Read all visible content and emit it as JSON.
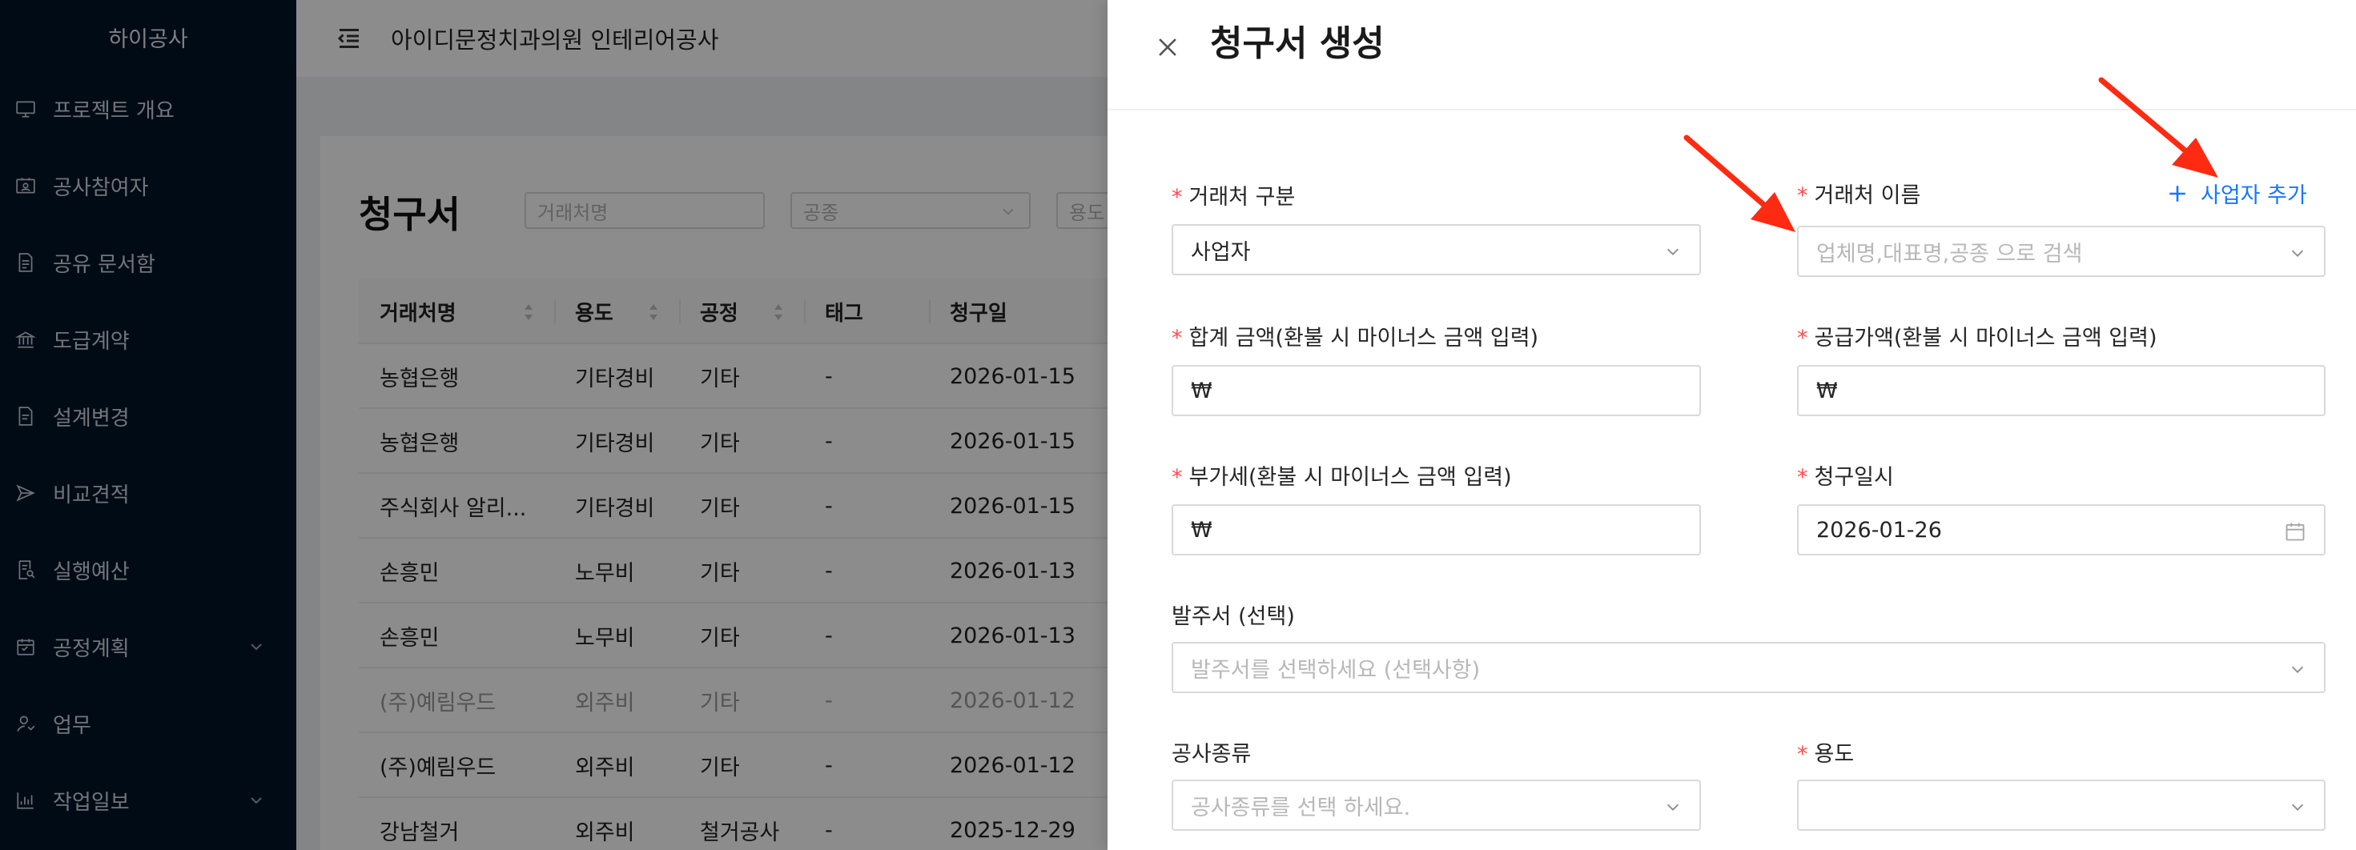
{
  "sidebar": {
    "brand": "하이공사",
    "items": [
      {
        "label": "프로젝트 개요",
        "icon": "monitor-icon"
      },
      {
        "label": "공사참여자",
        "icon": "id-card-icon"
      },
      {
        "label": "공유 문서함",
        "icon": "document-icon"
      },
      {
        "label": "도급계약",
        "icon": "bank-icon"
      },
      {
        "label": "설계변경",
        "icon": "file-edit-icon"
      },
      {
        "label": "비교견적",
        "icon": "send-icon"
      },
      {
        "label": "실행예산",
        "icon": "audit-icon"
      },
      {
        "label": "공정계획",
        "icon": "calendar-icon",
        "expandable": true
      },
      {
        "label": "업무",
        "icon": "user-switch-icon"
      },
      {
        "label": "작업일보",
        "icon": "bar-chart-icon",
        "expandable": true
      }
    ]
  },
  "header": {
    "project_title": "아이디문정치과의원 인테리어공사"
  },
  "page": {
    "title": "청구서",
    "filters": {
      "vendor_placeholder": "거래처명",
      "trade_placeholder": "공종",
      "usage_placeholder": "용도"
    }
  },
  "table": {
    "columns": [
      "거래처명",
      "용도",
      "공정",
      "태그",
      "청구일"
    ],
    "rows": [
      {
        "vendor": "농협은행",
        "usage": "기타경비",
        "process": "기타",
        "tag": "-",
        "date": "2026-01-15",
        "dim": false
      },
      {
        "vendor": "농협은행",
        "usage": "기타경비",
        "process": "기타",
        "tag": "-",
        "date": "2026-01-15",
        "dim": false
      },
      {
        "vendor": "주식회사 알리...",
        "usage": "기타경비",
        "process": "기타",
        "tag": "-",
        "date": "2026-01-15",
        "dim": false
      },
      {
        "vendor": "손흥민",
        "usage": "노무비",
        "process": "기타",
        "tag": "-",
        "date": "2026-01-13",
        "dim": false
      },
      {
        "vendor": "손흥민",
        "usage": "노무비",
        "process": "기타",
        "tag": "-",
        "date": "2026-01-13",
        "dim": false
      },
      {
        "vendor": "(주)예림우드",
        "usage": "외주비",
        "process": "기타",
        "tag": "-",
        "date": "2026-01-12",
        "dim": true
      },
      {
        "vendor": "(주)예림우드",
        "usage": "외주비",
        "process": "기타",
        "tag": "-",
        "date": "2026-01-12",
        "dim": false
      },
      {
        "vendor": "강남철거",
        "usage": "외주비",
        "process": "철거공사",
        "tag": "-",
        "date": "2025-12-29",
        "dim": false
      }
    ]
  },
  "drawer": {
    "title": "청구서 생성",
    "fields": {
      "vendor_type": {
        "label": "거래처 구분",
        "required": "*",
        "value": "사업자"
      },
      "vendor_name": {
        "label": "거래처 이름",
        "required": "*",
        "placeholder": "업체명,대표명,공종 으로 검색"
      },
      "add_business": "사업자 추가",
      "total_amount": {
        "label": "합계 금액(환불 시 마이너스 금액 입력)",
        "required": "*",
        "prefix": "₩"
      },
      "supply_amount": {
        "label": "공급가액(환불 시 마이너스 금액 입력)",
        "required": "*",
        "prefix": "₩"
      },
      "vat": {
        "label": "부가세(환불 시 마이너스 금액 입력)",
        "required": "*",
        "prefix": "₩"
      },
      "billing_date": {
        "label": "청구일시",
        "required": "*",
        "value": "2026-01-26"
      },
      "purchase_order": {
        "label": "발주서 (선택)",
        "placeholder": "발주서를 선택하세요 (선택사항)"
      },
      "work_type": {
        "label": "공사종류",
        "placeholder": "공사종류를 선택 하세요."
      },
      "usage": {
        "label": "용도",
        "required": "*"
      }
    }
  },
  "colors": {
    "sidebar_bg": "#001529",
    "accent": "#1677ff",
    "required": "#ff4d4f",
    "annotation_arrow": "#ff2a12"
  }
}
